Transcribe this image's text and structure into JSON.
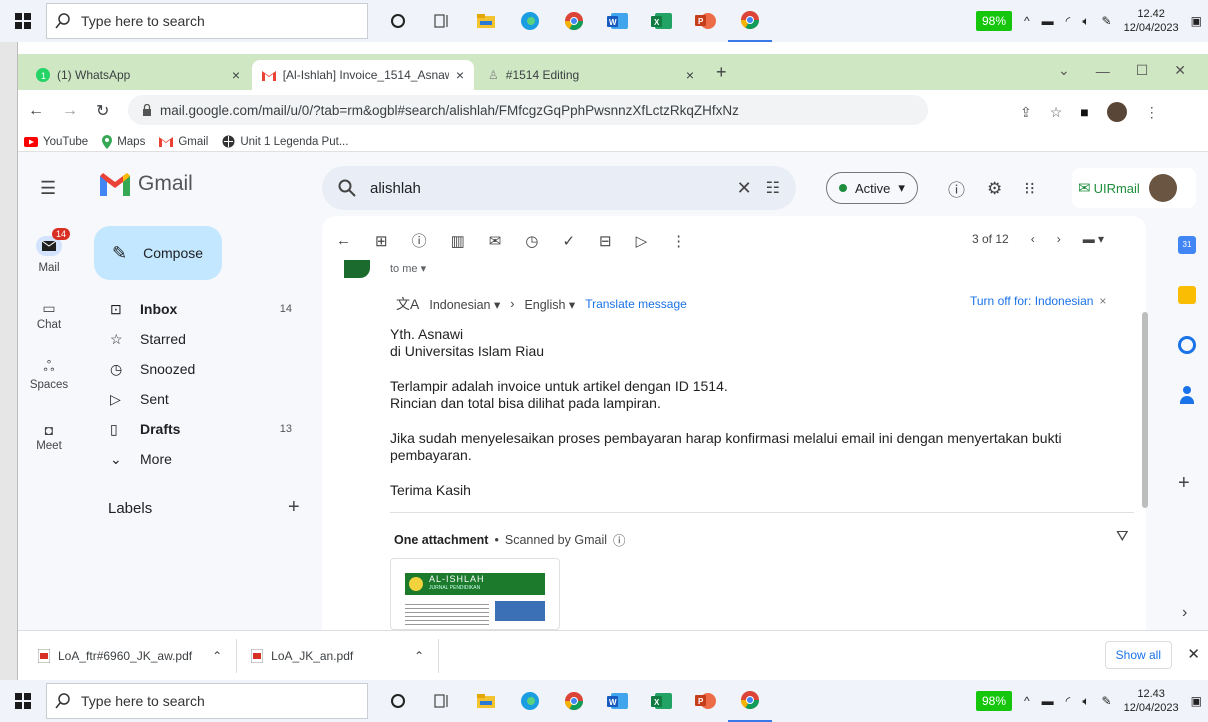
{
  "taskbar": {
    "search_placeholder": "Type here to search",
    "battery": "98%",
    "top_time": "12.42",
    "top_date": "12/04/2023",
    "bottom_time": "12.43",
    "bottom_date": "12/04/2023"
  },
  "tabs": [
    {
      "label": "(1) WhatsApp",
      "close": "×"
    },
    {
      "label": "[Al-Ishlah] Invoice_1514_Asnawi",
      "close": "×"
    },
    {
      "label": "#1514 Editing",
      "close": "×"
    }
  ],
  "new_tab": "+",
  "url": "mail.google.com/mail/u/0/?tab=rm&ogbl#search/alishlah/FMfcgzGqPphPwsnnzXfLctzRkqZHfxNz",
  "bookmarks": [
    "YouTube",
    "Maps",
    "Gmail",
    "Unit 1 Legenda Put..."
  ],
  "gmail": {
    "logo_text": "Gmail",
    "search_query": "alishlah",
    "status": "Active",
    "account_brand": "UIRmail",
    "compose": "Compose",
    "rail": [
      {
        "label": "Mail",
        "badge": "14"
      },
      {
        "label": "Chat"
      },
      {
        "label": "Spaces"
      },
      {
        "label": "Meet"
      }
    ],
    "nav": [
      {
        "label": "Inbox",
        "count": "14"
      },
      {
        "label": "Starred",
        "count": ""
      },
      {
        "label": "Snoozed",
        "count": ""
      },
      {
        "label": "Sent",
        "count": ""
      },
      {
        "label": "Drafts",
        "count": "13"
      },
      {
        "label": "More",
        "count": ""
      }
    ],
    "labels_heading": "Labels",
    "pager": "3 of 12",
    "to_me": "to me",
    "translate": {
      "from": "Indonesian",
      "to": "English",
      "action": "Translate message",
      "turn_off": "Turn off for: Indonesian"
    },
    "body": {
      "line1": "Yth. Asnawi",
      "line2": "di Universitas Islam Riau",
      "line3": "Terlampir adalah invoice untuk artikel dengan ID 1514.",
      "line4": "Rincian dan total bisa dilihat pada lampiran.",
      "line5": "Jika sudah menyelesaikan proses pembayaran harap konfirmasi melalui email ini dengan menyertakan bukti",
      "line6": "pembayaran.",
      "line7": "Terima Kasih"
    },
    "attachment": {
      "heading": "One attachment",
      "scanned": "Scanned by Gmail",
      "thumb_title": "AL-ISHLAH",
      "thumb_sub": "JURNAL PENDIDIKAN"
    }
  },
  "downloads": [
    {
      "name": "LoA_ftr#6960_JK_aw.pdf"
    },
    {
      "name": "LoA_JK_an.pdf"
    }
  ],
  "show_all": "Show all",
  "colors": {
    "tab_bar": "#cfe8c3",
    "gmail_bg": "#f6f8fc",
    "compose_bg": "#c2e7ff",
    "link_blue": "#1a73e8",
    "active_green": "#1e8e3e",
    "battery_green": "#16c60c"
  }
}
